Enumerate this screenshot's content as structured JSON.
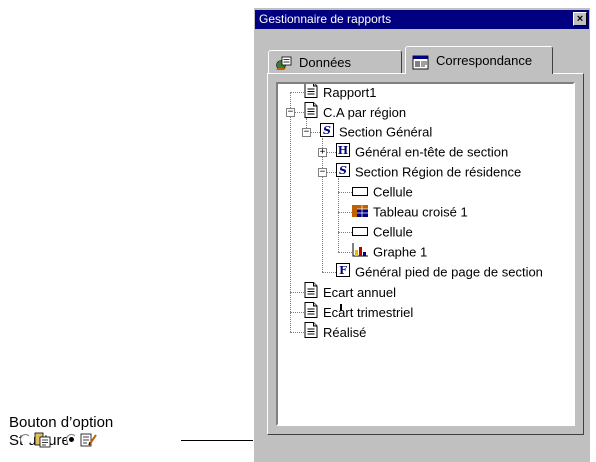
{
  "window": {
    "title": "Gestionnaire de rapports",
    "close_glyph": "×"
  },
  "tabs": [
    {
      "label": "Données",
      "icon": "data-tab-icon",
      "active": false
    },
    {
      "label": "Correspondance",
      "icon": "map-tab-icon",
      "active": true
    }
  ],
  "tree": [
    {
      "label": "Rapport1",
      "icon": "report-icon"
    },
    {
      "label": "C.A par région",
      "icon": "report-icon",
      "expanded": true
    },
    {
      "label": "Section Général",
      "icon": "section-icon",
      "expanded": true
    },
    {
      "label": "Général en-tête de section",
      "icon": "header-icon",
      "expanded": false
    },
    {
      "label": "Section Région de résidence",
      "icon": "section-icon",
      "expanded": true
    },
    {
      "label": "Cellule",
      "icon": "cell-icon"
    },
    {
      "label": "Tableau croisé  1",
      "icon": "crosstab-icon"
    },
    {
      "label": "Cellule",
      "icon": "cell-icon"
    },
    {
      "label": "Graphe 1",
      "icon": "chart-icon"
    },
    {
      "label": "Général pied de page de section",
      "icon": "footer-icon"
    },
    {
      "label": "Ecart annuel",
      "icon": "report-icon"
    },
    {
      "label": "Ecart trimestriel",
      "icon": "report-icon"
    },
    {
      "label": "Réalisé",
      "icon": "report-icon"
    }
  ],
  "icon_letters": {
    "section": "S",
    "header": "H",
    "footer": "F"
  },
  "options": [
    {
      "icon": "document-structure-icon",
      "selected": false
    },
    {
      "icon": "structure-option-icon",
      "selected": true
    }
  ],
  "callout": {
    "line1": "Bouton d’option",
    "line2": "Structure"
  }
}
